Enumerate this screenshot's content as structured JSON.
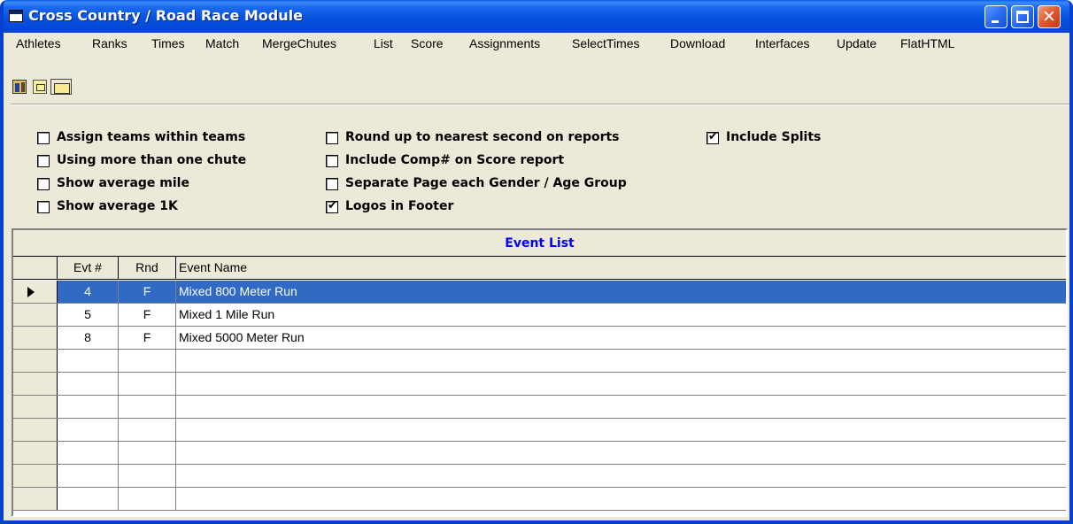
{
  "window": {
    "title": "Cross Country / Road Race Module",
    "accent": "#0553E0"
  },
  "menu": [
    {
      "label": "Athletes"
    },
    {
      "label": "Ranks"
    },
    {
      "label": "Times"
    },
    {
      "label": "Match"
    },
    {
      "label": "MergeChutes"
    },
    {
      "label": "List"
    },
    {
      "label": "Score"
    },
    {
      "label": "Assignments"
    },
    {
      "label": "SelectTimes"
    },
    {
      "label": "Download"
    },
    {
      "label": "Interfaces"
    },
    {
      "label": "Update"
    },
    {
      "label": "FlatHTML"
    }
  ],
  "toolbar": {
    "icons": [
      "athlete-chart-icon",
      "report-icon",
      "folder-up-icon"
    ]
  },
  "options": {
    "assign_teams": {
      "label": "Assign teams within teams",
      "checked": false
    },
    "more_than_one_chute": {
      "label": "Using more than one chute",
      "checked": false
    },
    "show_avg_mile": {
      "label": "Show average mile",
      "checked": false
    },
    "show_avg_1k": {
      "label": "Show average 1K",
      "checked": false
    },
    "round_up": {
      "label": "Round up to nearest second on reports",
      "checked": false
    },
    "include_comp": {
      "label": "Include Comp# on Score report",
      "checked": false
    },
    "separate_page": {
      "label": "Separate Page each Gender / Age Group",
      "checked": false
    },
    "logos_footer": {
      "label": "Logos in Footer",
      "checked": true
    },
    "include_splits": {
      "label": "Include Splits",
      "checked": true
    }
  },
  "event_list": {
    "title": "Event List",
    "columns": {
      "evt": "Evt #",
      "rnd": "Rnd",
      "name": "Event Name"
    },
    "rows": [
      {
        "evt": "4",
        "rnd": "F",
        "name": "Mixed 800 Meter Run",
        "selected": true
      },
      {
        "evt": "5",
        "rnd": "F",
        "name": "Mixed 1 Mile Run",
        "selected": false
      },
      {
        "evt": "8",
        "rnd": "F",
        "name": "Mixed 5000 Meter Run",
        "selected": false
      },
      {
        "evt": "",
        "rnd": "",
        "name": "",
        "selected": false
      },
      {
        "evt": "",
        "rnd": "",
        "name": "",
        "selected": false
      },
      {
        "evt": "",
        "rnd": "",
        "name": "",
        "selected": false
      },
      {
        "evt": "",
        "rnd": "",
        "name": "",
        "selected": false
      },
      {
        "evt": "",
        "rnd": "",
        "name": "",
        "selected": false
      },
      {
        "evt": "",
        "rnd": "",
        "name": "",
        "selected": false
      },
      {
        "evt": "",
        "rnd": "",
        "name": "",
        "selected": false
      }
    ]
  },
  "colors": {
    "selection": "#316AC5",
    "grid_title": "#0000FF",
    "face": "#ECE9D8"
  }
}
